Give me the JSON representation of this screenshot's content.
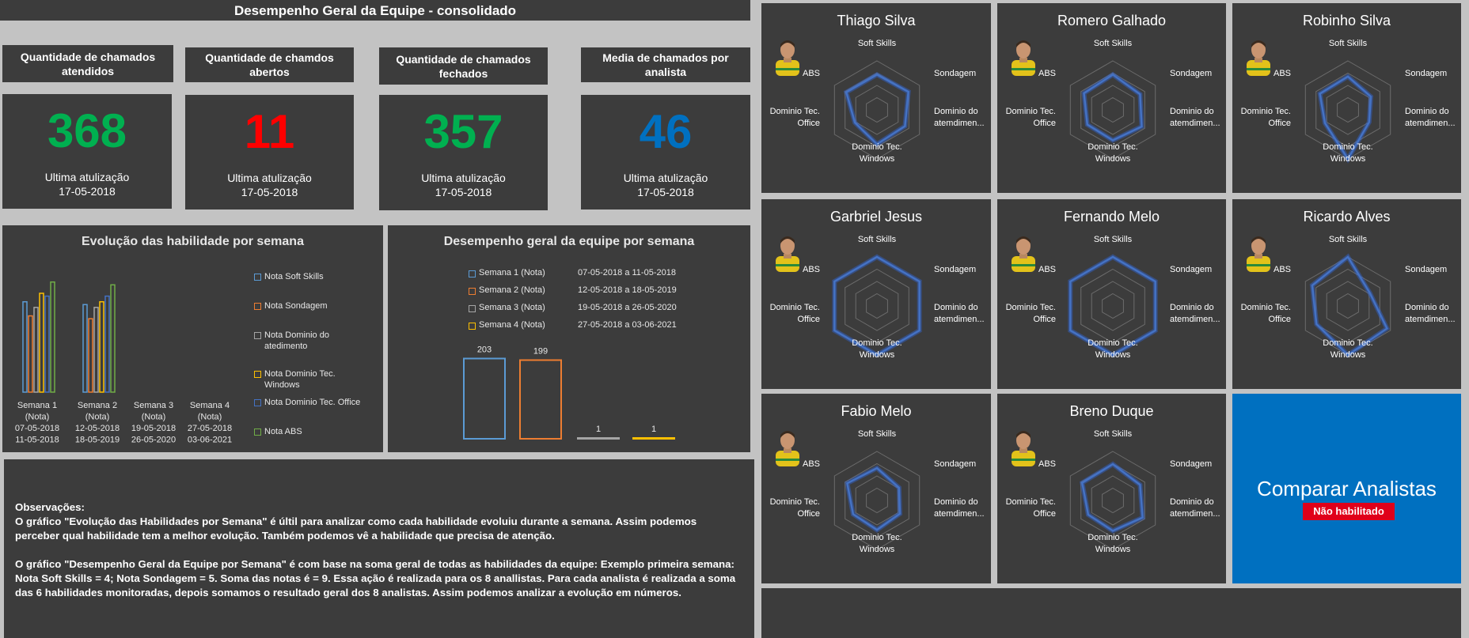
{
  "header": {
    "title": "Desempenho Geral da Equipe - consolidado"
  },
  "kpis": [
    {
      "label": "Quantidade de chamados atendidos",
      "value": "368",
      "color": "#00b050",
      "update_label": "Ultima atulização",
      "update_date": "17-05-2018"
    },
    {
      "label": "Quantidade de chamdos abertos",
      "value": "11",
      "color": "#ff0000",
      "update_label": "Ultima atulização",
      "update_date": "17-05-2018"
    },
    {
      "label": "Quantidade de chamados fechados",
      "value": "357",
      "color": "#00b050",
      "update_label": "Ultima atulização",
      "update_date": "17-05-2018"
    },
    {
      "label": "Media de chamados por analista",
      "value": "46",
      "color": "#0070c0",
      "update_label": "Ultima atulização",
      "update_date": "17-05-2018"
    }
  ],
  "evolution_chart": {
    "title": "Evolução das habilidade por semana",
    "series": [
      {
        "name": "Nota Soft Skills",
        "color": "#5b9bd5"
      },
      {
        "name": "Nota Sondagem",
        "color": "#ed7d31"
      },
      {
        "name": "Nota Dominio do atedimento",
        "color": "#a5a5a5"
      },
      {
        "name": "Nota Dominio Tec. Windows",
        "color": "#ffc000"
      },
      {
        "name": "Nota Dominio Tec. Office",
        "color": "#4472c4"
      },
      {
        "name": "Nota ABS",
        "color": "#70ad47"
      }
    ],
    "categories": [
      {
        "name": "Semana 1",
        "sub": "(Nota)",
        "d1": "07-05-2018",
        "d2": "11-05-2018"
      },
      {
        "name": "Semana 2",
        "sub": "(Nota)",
        "d1": "12-05-2018",
        "d2": "18-05-2019"
      },
      {
        "name": "Semana 3",
        "sub": "(Nota)",
        "d1": "19-05-2018",
        "d2": "26-05-2020"
      },
      {
        "name": "Semana 4",
        "sub": "(Nota)",
        "d1": "27-05-2018",
        "d2": "03-06-2021"
      }
    ],
    "chart_data": {
      "type": "bar",
      "categories": [
        "Semana 1",
        "Semana 2",
        "Semana 3",
        "Semana 4"
      ],
      "series": [
        {
          "name": "Nota Soft Skills",
          "values": [
            32,
            31,
            0,
            0
          ]
        },
        {
          "name": "Nota Sondagem",
          "values": [
            27,
            26,
            0,
            0
          ]
        },
        {
          "name": "Nota Dominio do atedimento",
          "values": [
            30,
            30,
            0,
            0
          ]
        },
        {
          "name": "Nota Dominio Tec. Windows",
          "values": [
            35,
            32,
            0,
            0
          ]
        },
        {
          "name": "Nota Dominio Tec. Office",
          "values": [
            34,
            34,
            0,
            0
          ]
        },
        {
          "name": "Nota ABS",
          "values": [
            39,
            38,
            0,
            0
          ]
        }
      ],
      "ylim": [
        0,
        42
      ]
    }
  },
  "team_chart": {
    "title": "Desempenho geral da equipe por semana",
    "legend": [
      {
        "name": "Semana 1 (Nota)",
        "range": "07-05-2018 a 11-05-2018",
        "color": "#5b9bd5"
      },
      {
        "name": "Semana 2 (Nota)",
        "range": "12-05-2018 a 18-05-2019",
        "color": "#ed7d31"
      },
      {
        "name": "Semana 3 (Nota)",
        "range": "19-05-2018 a 26-05-2020",
        "color": "#a5a5a5"
      },
      {
        "name": "Semana 4 (Nota)",
        "range": "27-05-2018 a 03-06-2021",
        "color": "#ffc000"
      }
    ],
    "chart_data": {
      "type": "bar",
      "categories": [
        "Semana 1 (Nota)",
        "Semana 2 (Nota)",
        "Semana 3 (Nota)",
        "Semana 4 (Nota)"
      ],
      "values": [
        203,
        199,
        1,
        1
      ],
      "ylim": [
        0,
        210
      ]
    },
    "value_labels": [
      "203",
      "199",
      "1",
      "1"
    ]
  },
  "observations": {
    "heading": "Observações:",
    "p1": "O gráfico \"Evolução das Habilidades por Semana\" é últil para analizar como cada habilidade evoluiu durante a semana. Assim podemos perceber qual habilidade tem a melhor evolução. Também podemos vê a habilidade que precisa de atenção.",
    "p2": "O gráfico \"Desempenho Geral da Equipe por Semana\" é com base na soma geral de todas as habilidades da equipe: Exemplo primeira semana: Nota Soft Skills = 4; Nota Sondagem = 5.  Soma das notas é = 9. Essa ação é realizada para os 8 anallistas. Para cada analista é realizada a soma das 6 habilidades monitoradas, depois somamos o resultado geral dos 8 analistas. Assim podemos analizar a evolução em números."
  },
  "radar_axes": [
    "Soft Skills",
    "Sondagem",
    "Dominio do|atemdimen...",
    "Dominio Tec.|Windows",
    "Dominio Tec.|Office",
    "ABS"
  ],
  "radar_max": 5,
  "analysts": [
    {
      "name": "Thiago Silva",
      "values": [
        3.6,
        3.7,
        3.3,
        3.5,
        2.6,
        3.6
      ]
    },
    {
      "name": "Romero Galhado",
      "values": [
        3.6,
        3.2,
        3.4,
        3.1,
        3.0,
        3.4
      ]
    },
    {
      "name": "Robinho Silva",
      "values": [
        3.4,
        2.7,
        2.5,
        5.0,
        2.7,
        3.3
      ]
    },
    {
      "name": "Garbriel Jesus",
      "values": [
        5.0,
        5.0,
        5.0,
        5.0,
        5.0,
        5.0
      ]
    },
    {
      "name": "Fernando Melo",
      "values": [
        5.0,
        5.0,
        5.0,
        5.0,
        5.0,
        5.0
      ]
    },
    {
      "name": "Ricardo Alves",
      "values": [
        5.0,
        2.6,
        4.6,
        5.0,
        3.7,
        4.2
      ]
    },
    {
      "name": "Fabio Melo",
      "values": [
        3.3,
        2.6,
        2.7,
        3.0,
        2.8,
        3.5
      ]
    },
    {
      "name": "Breno Duque",
      "values": [
        3.7,
        3.2,
        3.5,
        3.1,
        2.9,
        3.6
      ]
    }
  ],
  "compare": {
    "label": "Comparar Analistas",
    "badge": "Não habilitado"
  },
  "colors": {
    "radar_line": "#4472c4",
    "panel": "#3c3c3c",
    "background": "#c3c3c3"
  }
}
